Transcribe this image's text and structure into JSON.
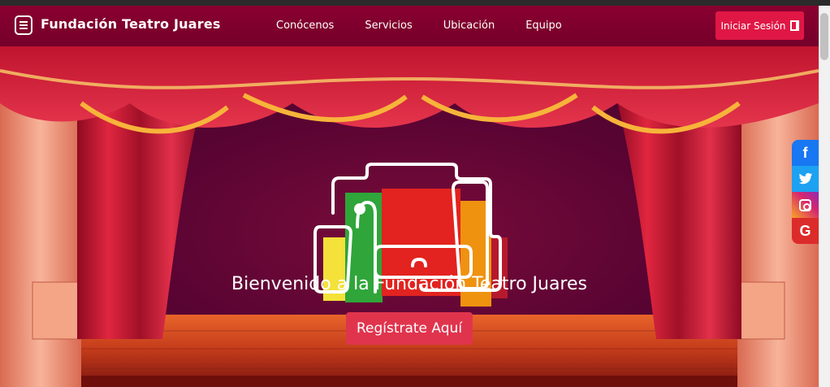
{
  "navbar": {
    "brand": "Fundación Teatro Juares",
    "links": [
      "Conócenos",
      "Servicios",
      "Ubicación",
      "Equipo"
    ],
    "login_label": "Iniciar Sesión"
  },
  "hero": {
    "welcome": "Bienvenido a la Fundación Teatro Juares",
    "register_label": "Regístrate Aquí"
  },
  "social": {
    "facebook_glyph": "f",
    "google_glyph": "G"
  },
  "colors": {
    "navbar": "#80002d",
    "login_button": "#e01745",
    "register_button": "#e0344d",
    "facebook": "#1877f2",
    "twitter": "#1da1f2",
    "google": "#dc2b2b"
  }
}
